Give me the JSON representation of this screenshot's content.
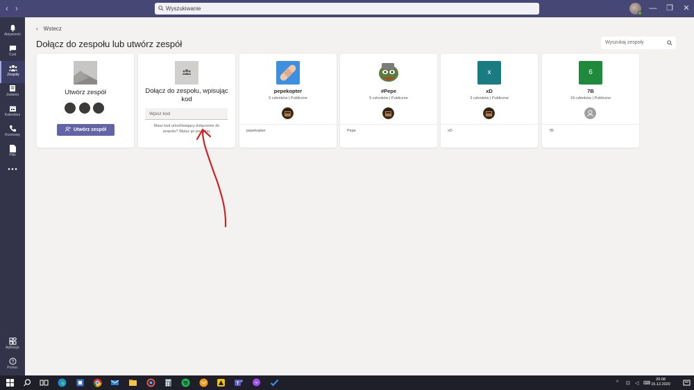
{
  "titlebar": {
    "search_placeholder": "Wyszukiwanie",
    "back_arrow": "‹",
    "forward_arrow": "›"
  },
  "rail": {
    "items": [
      {
        "label": "Aktywność",
        "icon": "bell-icon"
      },
      {
        "label": "Czat",
        "icon": "chat-icon"
      },
      {
        "label": "Zespoły",
        "icon": "teams-icon"
      },
      {
        "label": "Zadania",
        "icon": "assignments-icon"
      },
      {
        "label": "Kalendarz",
        "icon": "calendar-icon"
      },
      {
        "label": "Rozmowy",
        "icon": "phone-icon"
      },
      {
        "label": "Pliki",
        "icon": "file-icon"
      },
      {
        "label": "",
        "icon": "more-icon"
      }
    ],
    "bottom": [
      {
        "label": "Aplikacje",
        "icon": "apps-icon"
      },
      {
        "label": "Pomoc",
        "icon": "help-icon"
      }
    ]
  },
  "main": {
    "back_label": "Wstecz",
    "title": "Dołącz do zespołu lub utwórz zespół",
    "team_search_placeholder": "Wyszukaj zespoły",
    "create_card": {
      "title": "Utwórz zespół",
      "button_label": "Utwórz zespół"
    },
    "join_card": {
      "title": "Dołącz do zespołu, wpisując kod",
      "input_placeholder": "Wpisz kod",
      "help": "Masz kod umożliwiający dołączenie do zespołu? Wpisz go powyżej."
    },
    "teams": [
      {
        "name": "pepekopter",
        "meta": "5 członków | Publiczne",
        "desc": "pepekopter",
        "logo": "bandage-icon"
      },
      {
        "name": "#Pepe",
        "meta": "5 członków | Publiczne",
        "desc": "Pepe",
        "logo": "pepe-icon"
      },
      {
        "name": "xD",
        "meta": "3 członków | Publiczne",
        "desc": "xD",
        "logo_text": "x",
        "logo_color": "#1b7b82"
      },
      {
        "name": "7B",
        "meta": "19 członków | Publiczne",
        "desc": "7B",
        "logo_text": "6",
        "logo_color": "#208a3c"
      }
    ]
  },
  "taskbar": {
    "time": "20:08",
    "date": "15.12.2020"
  },
  "colors": {
    "brand": "#464775",
    "rail": "#33344a",
    "accent": "#6264a7",
    "annotation": "#d42020"
  }
}
